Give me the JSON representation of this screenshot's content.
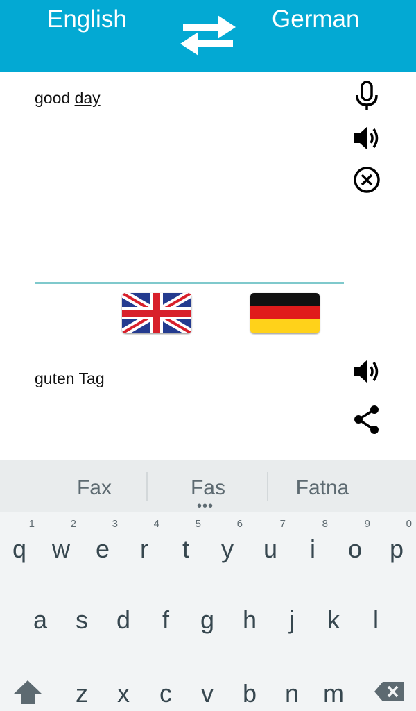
{
  "header": {
    "source_language": "English",
    "target_language": "German",
    "swap_icon": "swap-arrows-icon",
    "background_color": "#03a9d3"
  },
  "input": {
    "text_plain": "good ",
    "text_underlined": "day",
    "mic_icon": "microphone-icon",
    "speak_icon": "speaker-icon",
    "clear_icon": "clear-circle-x-icon"
  },
  "flags": {
    "source_flag": "uk-flag-icon",
    "target_flag": "germany-flag-icon"
  },
  "output": {
    "text": "guten Tag",
    "speak_icon": "speaker-icon",
    "share_icon": "share-icon"
  },
  "keyboard": {
    "suggestions": [
      "Fax",
      "Fas",
      "Fatna"
    ],
    "more_indicator": "•••",
    "row1": [
      {
        "key": "q",
        "hint": "1"
      },
      {
        "key": "w",
        "hint": "2"
      },
      {
        "key": "e",
        "hint": "3"
      },
      {
        "key": "r",
        "hint": "4"
      },
      {
        "key": "t",
        "hint": "5"
      },
      {
        "key": "y",
        "hint": "6"
      },
      {
        "key": "u",
        "hint": "7"
      },
      {
        "key": "i",
        "hint": "8"
      },
      {
        "key": "o",
        "hint": "9"
      },
      {
        "key": "p",
        "hint": "0"
      }
    ],
    "row2": [
      "a",
      "s",
      "d",
      "f",
      "g",
      "h",
      "j",
      "k",
      "l"
    ],
    "row3": [
      "z",
      "x",
      "c",
      "v",
      "b",
      "n",
      "m"
    ],
    "shift_icon": "shift-arrow-icon",
    "backspace_icon": "backspace-icon"
  }
}
